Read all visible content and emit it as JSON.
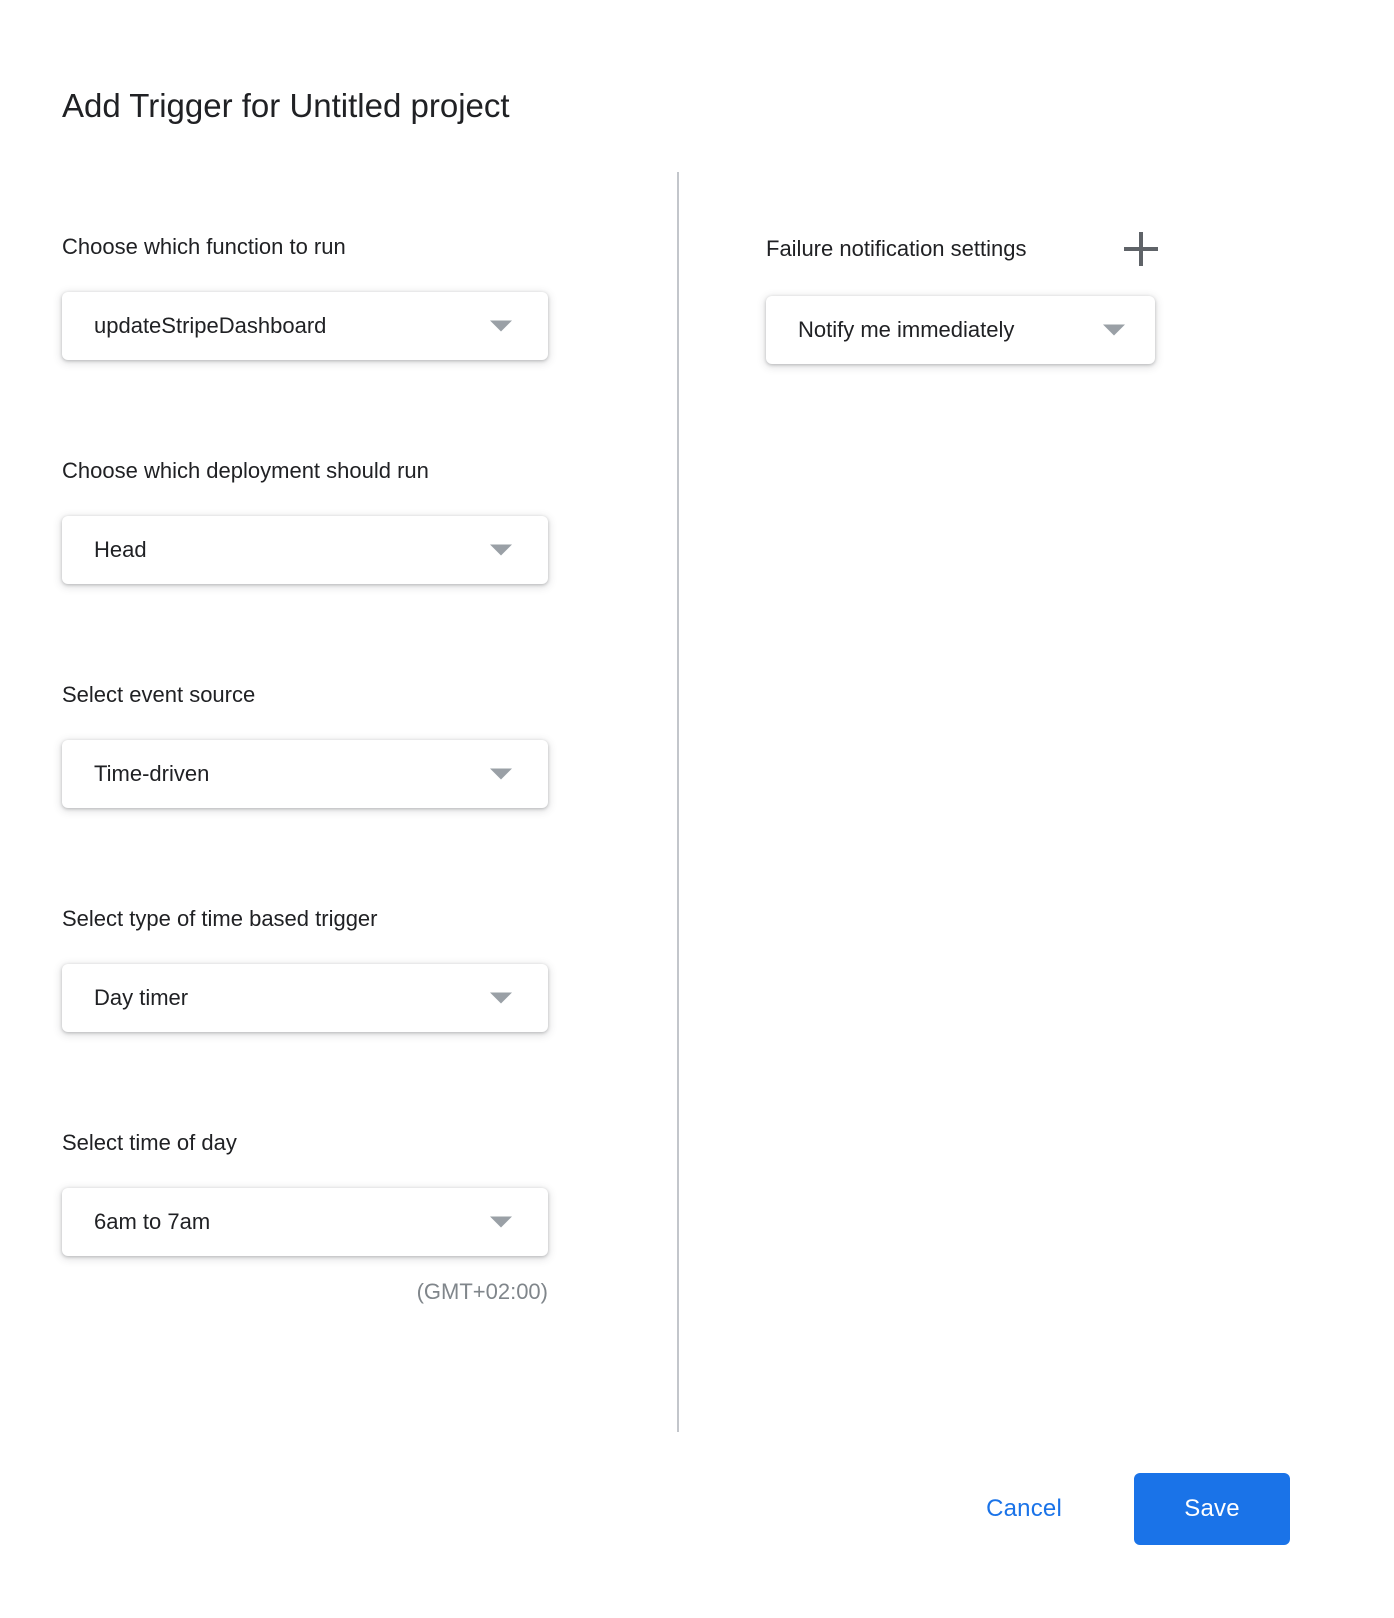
{
  "dialog": {
    "title": "Add Trigger for Untitled project"
  },
  "left_column": {
    "fields": [
      {
        "label": "Choose which function to run",
        "value": "updateStripeDashboard"
      },
      {
        "label": "Choose which deployment should run",
        "value": "Head"
      },
      {
        "label": "Select event source",
        "value": "Time-driven"
      },
      {
        "label": "Select type of time based trigger",
        "value": "Day timer"
      },
      {
        "label": "Select time of day",
        "value": "6am to 7am"
      }
    ],
    "timezone_note": "(GMT+02:00)"
  },
  "right_column": {
    "header_label": "Failure notification settings",
    "add_icon": "plus-icon",
    "notification": {
      "value": "Notify me immediately"
    }
  },
  "footer": {
    "cancel_label": "Cancel",
    "save_label": "Save"
  },
  "colors": {
    "accent": "#1a73e8",
    "text_primary": "#202124",
    "text_muted": "#80868b",
    "icon": "#5f6368",
    "arrow": "#9aa0a6",
    "divider": "#c3c6cb",
    "surface": "#ffffff"
  }
}
